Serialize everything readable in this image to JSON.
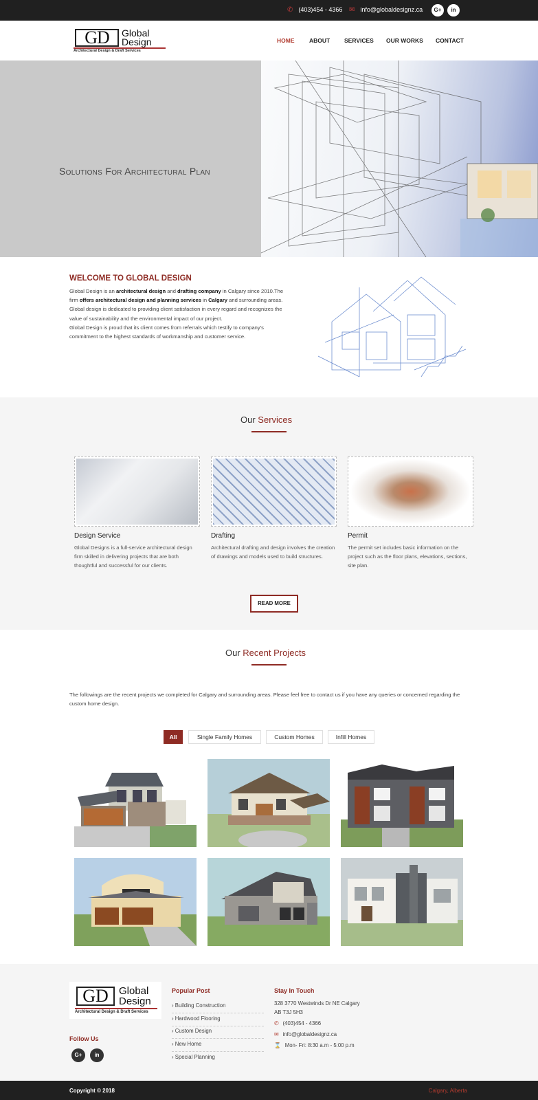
{
  "topbar": {
    "phone": "(403)454 - 4366",
    "email": "info@globaldesignz.ca",
    "social": [
      "G+",
      "in"
    ]
  },
  "logo": {
    "mark": "GD",
    "name_line1": "Global",
    "name_line2": "Design",
    "tagline": "Architectural Design & Draft Services"
  },
  "nav": {
    "items": [
      {
        "label": "HOME",
        "active": true
      },
      {
        "label": "ABOUT",
        "active": false
      },
      {
        "label": "SERVICES",
        "active": false
      },
      {
        "label": "OUR WORKS",
        "active": false
      },
      {
        "label": "CONTACT",
        "active": false
      }
    ]
  },
  "hero": {
    "title": "Solutions For Architectural Plan"
  },
  "welcome": {
    "title": "WELCOME TO GLOBAL DESIGN",
    "p1_a": "Global Design is an ",
    "p1_b": "architectural design",
    "p1_c": " and ",
    "p1_d": "drafting company",
    "p1_e": " in Calgary since 2010.The firm ",
    "p1_f": "offers architectural design and planning services",
    "p1_g": " in ",
    "p1_h": "Calgary",
    "p1_i": " and surrounding areas. Global design is dedicated to providing client satisfaction in every regard and recognizes the value of sustainability and the environmental impact of our project.",
    "p2": "Global Design is proud that its client comes from referrals which testify to company's commitment to the highest standards of workmanship and customer service."
  },
  "services": {
    "title_a": "Our",
    "title_b": "Services",
    "items": [
      {
        "title": "Design Service",
        "text": "Global Designs is a full-service architectural design firm skilled in delivering projects that are both thoughtful and successful for our clients."
      },
      {
        "title": "Drafting",
        "text": "Architectural drafting and design involves the creation of drawings and models used to build structures."
      },
      {
        "title": "Permit",
        "text": "The permit set includes basic information on the project such as the floor plans, elevations, sections, site plan."
      }
    ],
    "button": "READ MORE"
  },
  "projects": {
    "title_a": "Our",
    "title_b": "Recent Projects",
    "intro": "The followings are the recent projects we completed for Calgary and surrounding areas. Please feel free to contact us if you have any queries or concerned regarding the custom home design.",
    "filters": [
      {
        "label": "All",
        "active": true
      },
      {
        "label": "Single Family Homes",
        "active": false
      },
      {
        "label": "Custom Homes",
        "active": false
      },
      {
        "label": "Infill Homes",
        "active": false
      }
    ]
  },
  "footer": {
    "follow": "Follow Us",
    "social": [
      "G+",
      "in"
    ],
    "popular_title": "Popular Post",
    "popular": [
      "Building Construction",
      "Hardwood Flooring",
      "Custom Design",
      "New Home",
      "Special Planning"
    ],
    "contact_title": "Stay In Touch",
    "address_line1": "328 3770 Westwinds Dr NE Calgary",
    "address_line2": "AB T3J 5H3",
    "phone": "(403)454 - 4366",
    "email": "info@globaldesignz.ca",
    "hours": "Mon- Fri: 8:30 a.m - 5:00 p.m"
  },
  "bottom": {
    "copyright": "Copyright © 2018",
    "location": "Calgary, Alberta"
  },
  "colors": {
    "accent": "#8e2b24",
    "dark": "#202020",
    "light_bg": "#f5f5f5"
  }
}
